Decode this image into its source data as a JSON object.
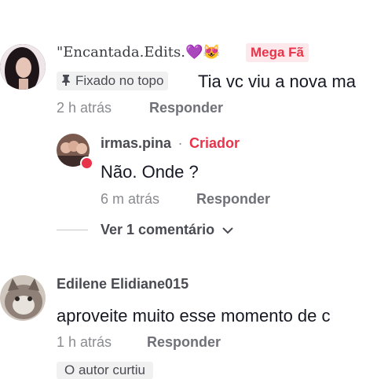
{
  "comments": [
    {
      "username": "\"Encantada.Edits.💜😻",
      "badge": "Mega Fã",
      "pinned": "Fixado no topo",
      "text": "Tia vc viu a nova ma",
      "time": "2 h atrás",
      "reply": "Responder"
    },
    {
      "username": "irmas.pina",
      "separator": "·",
      "creator": "Criador",
      "text": "Não. Onde ?",
      "time": "6 m atrás",
      "reply": "Responder",
      "view_more": "Ver 1 comentário"
    },
    {
      "username": "Edilene Elidiane015",
      "text": "aproveite muito esse momento de c",
      "time": "1 h atrás",
      "reply": "Responder",
      "liked": "O autor curtiu"
    }
  ]
}
